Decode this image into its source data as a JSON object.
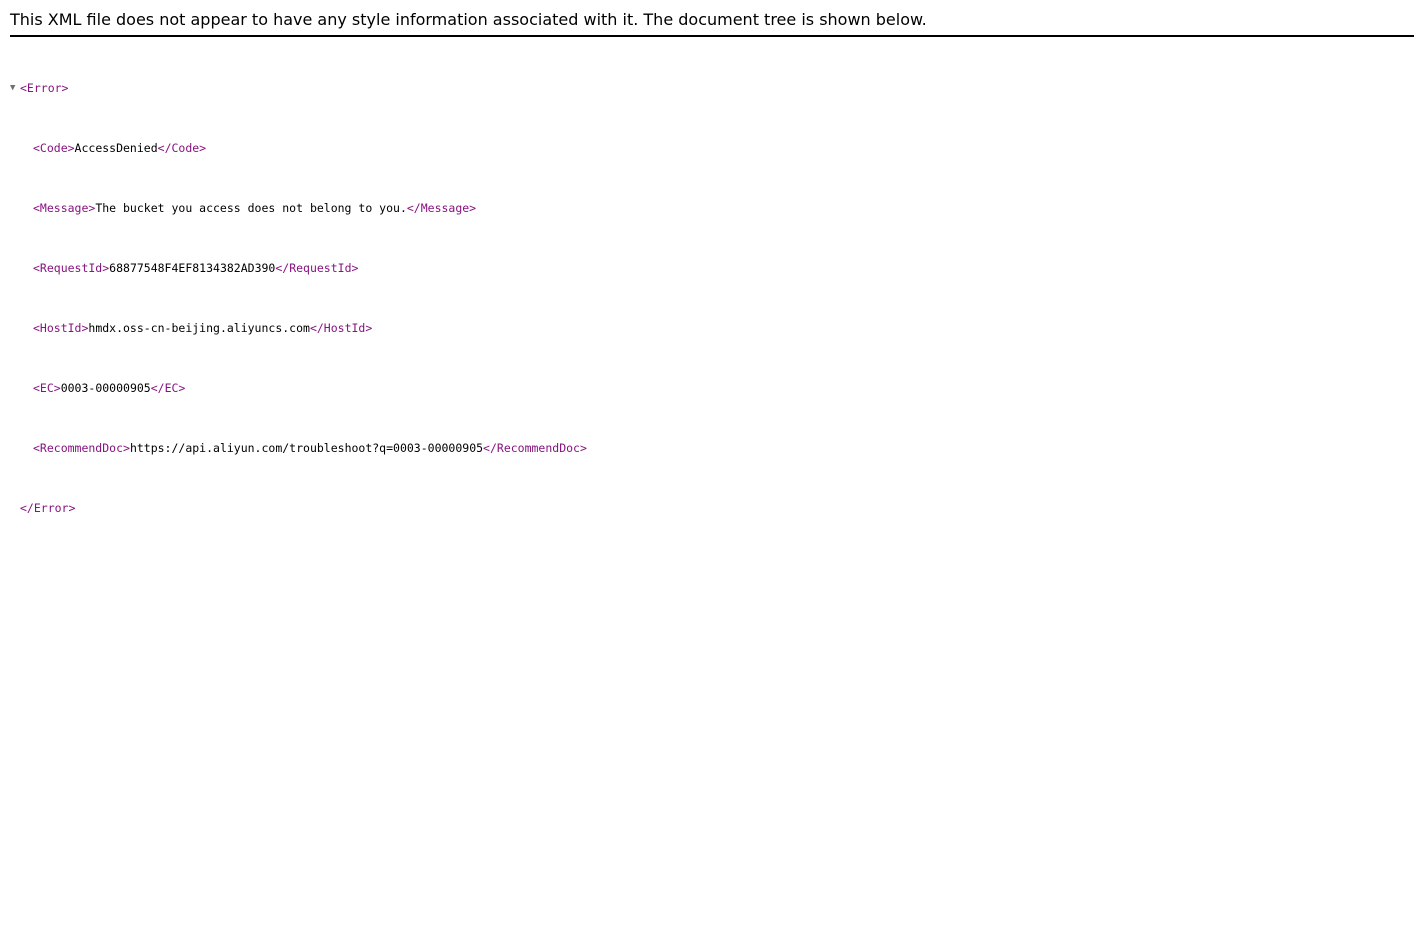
{
  "banner": {
    "text": "This XML file does not appear to have any style information associated with it. The document tree is shown below."
  },
  "tree": {
    "toggle_glyph": "▼",
    "root_open": "<Error>",
    "root_close": "</Error>",
    "children": [
      {
        "open": "<Code>",
        "value": "AccessDenied",
        "close": "</Code>"
      },
      {
        "open": "<Message>",
        "value": "The bucket you access does not belong to you.",
        "close": "</Message>"
      },
      {
        "open": "<RequestId>",
        "value": "68877548F4EF8134382AD390",
        "close": "</RequestId>"
      },
      {
        "open": "<HostId>",
        "value": "hmdx.oss-cn-beijing.aliyuncs.com",
        "close": "</HostId>"
      },
      {
        "open": "<EC>",
        "value": "0003-00000905",
        "close": "</EC>"
      },
      {
        "open": "<RecommendDoc>",
        "value": "https://api.aliyun.com/troubleshoot?q=0003-00000905",
        "close": "</RecommendDoc>"
      }
    ]
  },
  "colors": {
    "tag": "#881280",
    "text": "#000000",
    "rule": "#000000"
  }
}
